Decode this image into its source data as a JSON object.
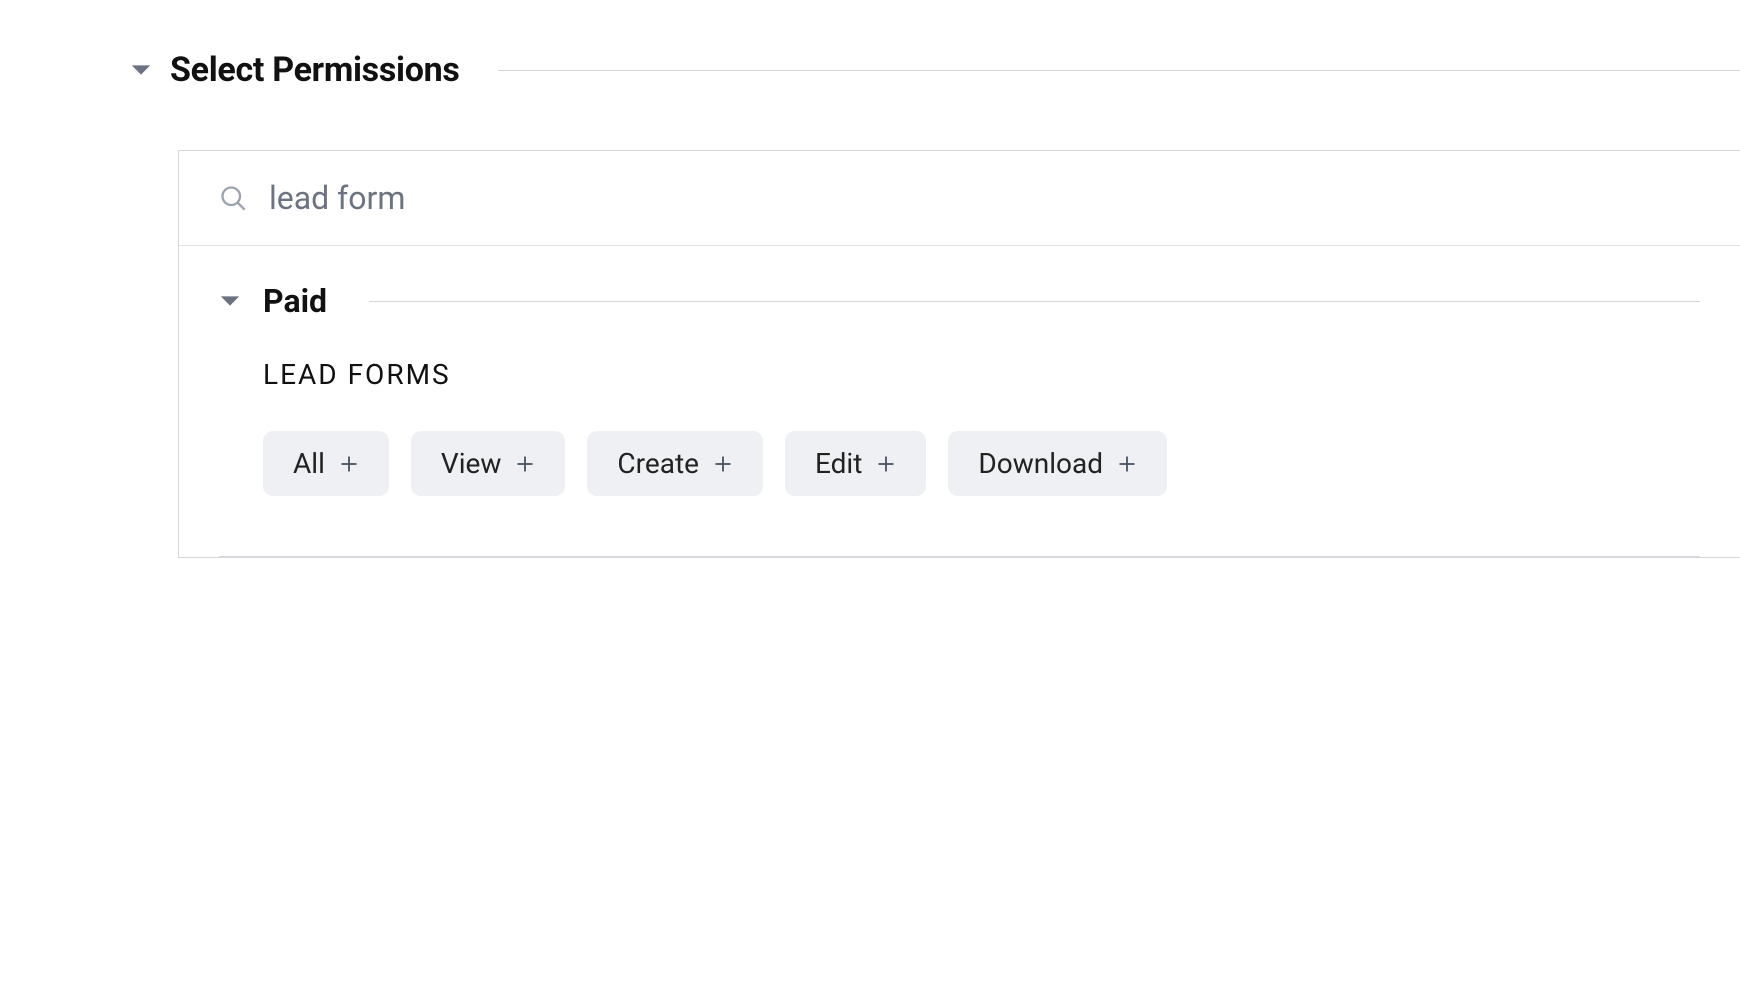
{
  "section": {
    "title": "Select Permissions"
  },
  "search": {
    "value": "lead form",
    "placeholder": ""
  },
  "group": {
    "title": "Paid",
    "categories": [
      {
        "label": "LEAD FORMS",
        "chips": [
          {
            "label": "All"
          },
          {
            "label": "View"
          },
          {
            "label": "Create"
          },
          {
            "label": "Edit"
          },
          {
            "label": "Download"
          }
        ]
      }
    ]
  }
}
